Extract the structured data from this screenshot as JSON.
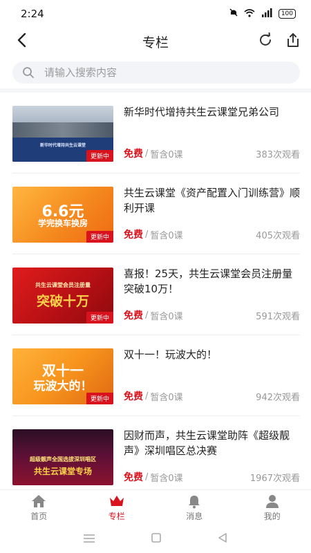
{
  "status": {
    "time": "2:24",
    "signal": "⁴ᴳ",
    "battery": "100"
  },
  "nav": {
    "title": "专栏"
  },
  "search": {
    "placeholder": "请输入搜索内容"
  },
  "items": [
    {
      "title": "新华时代增持共生云课堂兄弟公司",
      "price": "免费",
      "sep": "/",
      "lessons": "暂含0课",
      "views": "383次观看",
      "badge": "更新中",
      "thumb_text": "新华时代增持共生云课堂"
    },
    {
      "title": "共生云课堂《资产配置入门训练营》顺利开课",
      "price": "免费",
      "sep": "/",
      "lessons": "暂含0课",
      "views": "405次观看",
      "badge": "更新中",
      "thumb_text": "6.6元",
      "thumb_sub": "学完换车换房"
    },
    {
      "title": "喜报！25天，共生云课堂会员注册量突破10万！",
      "price": "免费",
      "sep": "/",
      "lessons": "暂含0课",
      "views": "591次观看",
      "badge": "更新中",
      "thumb_text": "突破十万",
      "thumb_sub": "共生云课堂会员注册量"
    },
    {
      "title": "双十一！玩波大的！",
      "price": "免费",
      "sep": "/",
      "lessons": "暂含0课",
      "views": "942次观看",
      "badge": "更新中",
      "thumb_text": "双十一",
      "thumb_sub": "玩波大的！"
    },
    {
      "title": "因财而声，共生云课堂助阵《超级靓声》深圳唱区总决赛",
      "price": "免费",
      "sep": "/",
      "lessons": "暂含0课",
      "views": "1967次观看",
      "badge": "",
      "thumb_text": "共生云课堂专场",
      "thumb_sub": "超级靓声全国选拔深圳唱区"
    }
  ],
  "tabs": [
    {
      "label": "首页",
      "icon": "home-icon"
    },
    {
      "label": "专栏",
      "icon": "crown-icon"
    },
    {
      "label": "消息",
      "icon": "bell-icon"
    },
    {
      "label": "我的",
      "icon": "user-icon"
    }
  ],
  "colors": {
    "accent": "#d8131e",
    "orange": "#f28a1e"
  }
}
